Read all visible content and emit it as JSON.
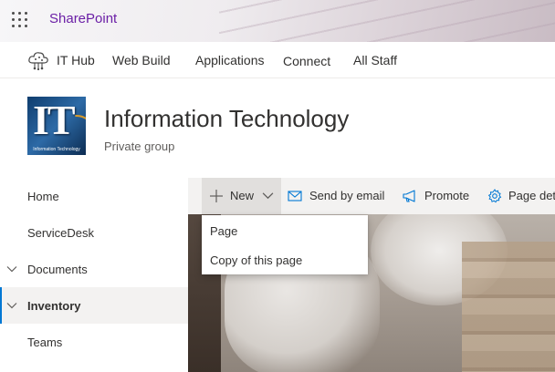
{
  "suite_bar": {
    "app_name": "SharePoint",
    "waffle_icon": "app-launcher-icon",
    "app_name_color": "#6b1fa6"
  },
  "hub_nav": {
    "hub_icon": "cloud-network-icon",
    "links": [
      "IT Hub",
      "Web Build",
      "Applications",
      "Connect",
      "All Staff"
    ]
  },
  "site_header": {
    "logo_text": "IT",
    "logo_subtext": "Information Technology",
    "title": "Information Technology",
    "subtitle": "Private group"
  },
  "left_nav": {
    "items": [
      {
        "label": "Home",
        "expandable": false,
        "selected": false
      },
      {
        "label": "ServiceDesk",
        "expandable": false,
        "selected": false
      },
      {
        "label": "Documents",
        "expandable": true,
        "selected": false
      },
      {
        "label": "Inventory",
        "expandable": true,
        "selected": true
      },
      {
        "label": "Teams",
        "expandable": false,
        "selected": false
      }
    ],
    "accent_color": "#0078d4"
  },
  "command_bar": {
    "new_label": "New",
    "send_email_label": "Send by email",
    "promote_label": "Promote",
    "page_details_label": "Page details",
    "icons": [
      "plus-icon",
      "chevron-down-icon",
      "mail-icon",
      "megaphone-icon",
      "gear-icon"
    ]
  },
  "new_menu": {
    "items": [
      "Page",
      "Copy of this page"
    ]
  }
}
